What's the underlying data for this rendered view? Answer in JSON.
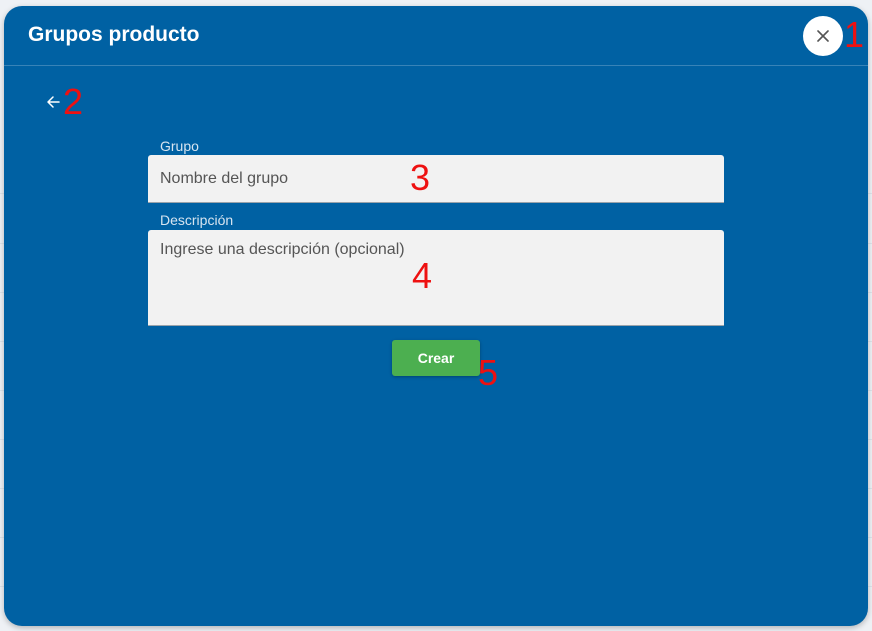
{
  "background": {
    "title_fragment": "producto"
  },
  "modal": {
    "title": "Grupos producto",
    "close_icon": "close-icon",
    "back_icon": "arrow-left-icon"
  },
  "form": {
    "group_label": "Grupo",
    "group_placeholder": "Nombre del grupo",
    "group_value": "",
    "description_label": "Descripción",
    "description_placeholder": "Ingrese una descripción (opcional)",
    "description_value": "",
    "submit_label": "Crear"
  },
  "annotations": [
    "1",
    "2",
    "3",
    "4",
    "5"
  ],
  "colors": {
    "modal_bg": "#0061a3",
    "submit_bg": "#4caf50",
    "marker": "#ee1111"
  }
}
